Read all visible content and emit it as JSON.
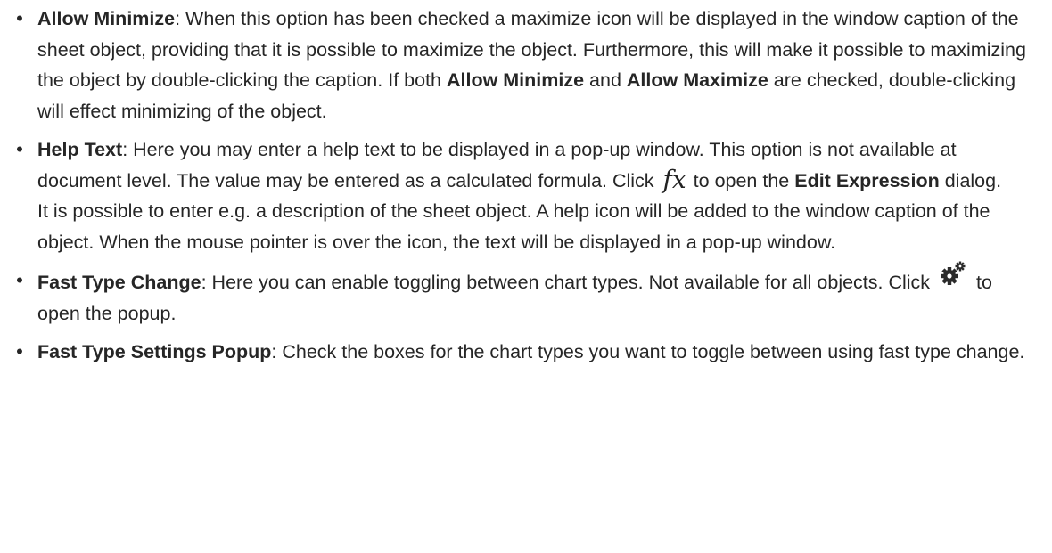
{
  "options": [
    {
      "term": "Allow Minimize",
      "sep": ": ",
      "text_1": "When this option has been checked a maximize icon will be displayed in the window caption of the sheet object, providing that it is possible to maximize the object. Furthermore, this will make it possible to maximizing the object by double-clicking the caption. If both ",
      "bold_2": "Allow Minimize",
      "text_2": " and ",
      "bold_3": "Allow Maximize",
      "text_3": " are checked, double-clicking will effect minimizing of the object."
    },
    {
      "term": "Help Text",
      "sep": ": ",
      "text_1": "Here you may enter a help text to be displayed in a pop-up window. This option is not available at document level. The value may be entered as a calculated formula. Click ",
      "icon_glyph": "fx",
      "icon_name": "fx-icon",
      "text_2": " to open the ",
      "bold_2": "Edit Expression",
      "text_3": " dialog.",
      "paragraph_2": "It is possible to enter e.g. a description of the sheet object. A help icon will be added to the window caption of the object. When the mouse pointer is over the icon, the text will be displayed in a pop-up window."
    },
    {
      "term": "Fast Type Change",
      "sep": ": ",
      "text_1": "Here you can enable toggling between chart types. Not available for all objects. Click ",
      "icon_name": "gear-icon",
      "text_2": " to open the popup."
    },
    {
      "term": "Fast Type Settings Popup",
      "sep": ": ",
      "text_1": "Check the boxes for the chart types you want to toggle between using fast type change."
    }
  ],
  "bullet": "•"
}
